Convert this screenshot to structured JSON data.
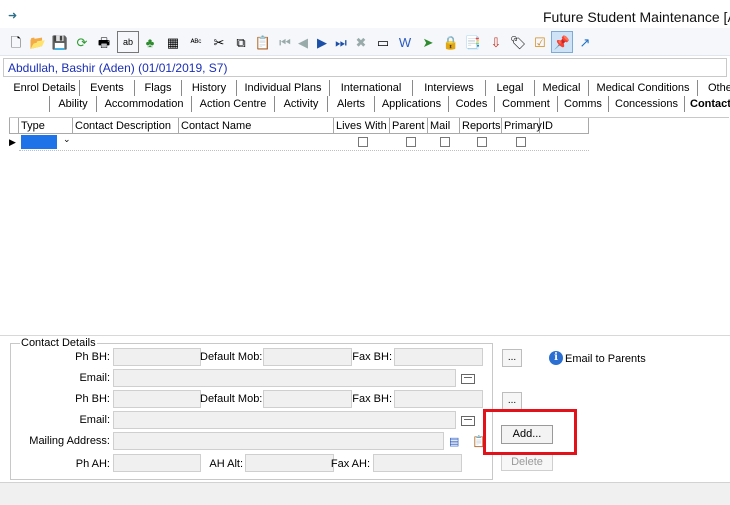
{
  "window": {
    "title": "Future Student Maintenance  [A"
  },
  "toolbar": {
    "icons": [
      "new-icon",
      "open-icon",
      "save-icon",
      "refresh-icon",
      "print-icon",
      "text-field-icon",
      "tree-icon",
      "calculator-icon",
      "spellcheck-icon",
      "cut-icon",
      "copy-icon",
      "paste-icon",
      "first-record-icon",
      "previous-record-icon",
      "next-record-icon",
      "last-record-icon",
      "delete-icon",
      "field-icon",
      "word-icon",
      "tag-icon",
      "lock-icon",
      "clipboard-icon",
      "export-icon",
      "label-icon",
      "checklist-icon",
      "pin-icon",
      "goto-icon"
    ],
    "active": "pin-icon"
  },
  "record": {
    "label": "Abdullah, Bashir (Aden) (01/01/2019, S7)"
  },
  "tabs_row1": [
    "Enrol Details",
    "Events",
    "Flags",
    "History",
    "Individual Plans",
    "International",
    "Interviews",
    "Legal",
    "Medical",
    "Medical Conditions",
    "Othe"
  ],
  "tabs_row2": [
    "Ability",
    "Accommodation",
    "Action Centre",
    "Activity",
    "Alerts",
    "Applications",
    "Codes",
    "Comment",
    "Comms",
    "Concessions",
    "Contact"
  ],
  "grid": {
    "columns": [
      "Type",
      "Contact Description",
      "Contact Name",
      "Lives With",
      "Parent",
      "Mail",
      "Reports",
      "Primary",
      "ID"
    ],
    "rows": [
      {
        "type": "",
        "description": "",
        "name": "",
        "lives_with": false,
        "parent": false,
        "mail": false,
        "reports": false,
        "primary": false,
        "id": ""
      }
    ]
  },
  "contact_details": {
    "legend": "Contact Details",
    "ph_bh_label": "Ph BH:",
    "default_mob_label": "Default Mob:",
    "fax_bh_label": "Fax BH:",
    "email_label": "Email:",
    "mailing_address_label": "Mailing Address:",
    "ph_ah_label": "Ph AH:",
    "ah_alt_label": "AH Alt:",
    "fax_ah_label": "Fax AH:",
    "values": {
      "ph_bh_1": "",
      "default_mob_1": "",
      "fax_bh_1": "",
      "email_1": "",
      "ph_bh_2": "",
      "default_mob_2": "",
      "fax_bh_2": "",
      "email_2": "",
      "mailing_address": "",
      "ph_ah": "",
      "ah_alt": "",
      "fax_ah": ""
    }
  },
  "actions": {
    "ellipsis": "...",
    "email_to_parents": "Email to Parents",
    "add": "Add...",
    "delete": "Delete"
  },
  "colors": {
    "record_text": "#1b2fb8",
    "highlight": "#e2111a",
    "selection": "#1e73e8"
  }
}
